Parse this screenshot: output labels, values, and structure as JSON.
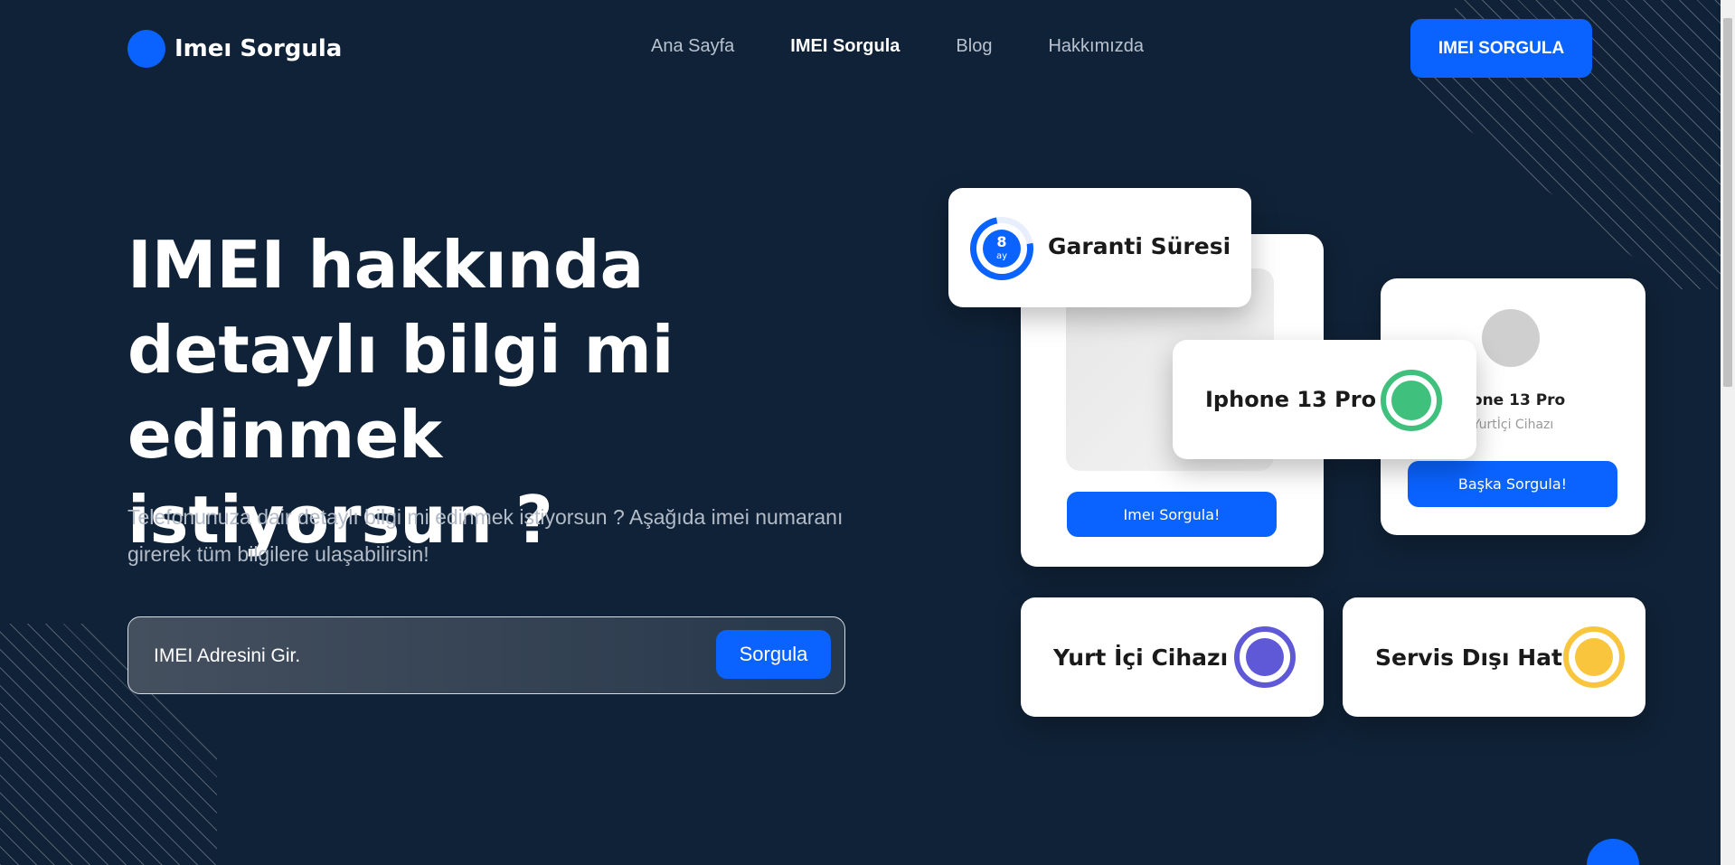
{
  "brand": {
    "name": "Imeı Sorgula",
    "color": "#0a63ff"
  },
  "nav": {
    "items": [
      {
        "label": "Ana Sayfa",
        "active": false
      },
      {
        "label": "IMEI Sorgula",
        "active": true
      },
      {
        "label": "Blog",
        "active": false
      },
      {
        "label": "Hakkımızda",
        "active": false
      }
    ]
  },
  "header": {
    "cta_label": "IMEI SORGULA"
  },
  "hero": {
    "title": "IMEI hakkında detaylı bilgi mi edinmek istiyorsun ?",
    "description": "Telefonunuza dair detaylı bilgi mi edinmek istiyorsun ? Aşağıda imei numaranı girerek tüm bilgilere ulaşabilirsin!",
    "search": {
      "placeholder": "IMEI Adresini Gir.",
      "value": "",
      "button_label": "Sorgula"
    }
  },
  "cards": {
    "main": {
      "button_label": "Imeı Sorgula!"
    },
    "side": {
      "title": "hone 13 Pro",
      "subtitle": "Yurtİçi Cihazı",
      "button_label": "Başka Sorgula!"
    },
    "warranty": {
      "label": "Garanti Süresi",
      "value": "8",
      "unit": "ay",
      "accent": "#0a63ff"
    },
    "device": {
      "label": "Iphone 13 Pro",
      "accent": "#3fc07d"
    },
    "domestic": {
      "label": "Yurt İçi Cihazı",
      "accent": "#5f59d8"
    },
    "service": {
      "label": "Servis Dışı Hat",
      "accent": "#f8c53d"
    }
  },
  "colors": {
    "background": "#102237",
    "primary": "#0a63ff"
  }
}
